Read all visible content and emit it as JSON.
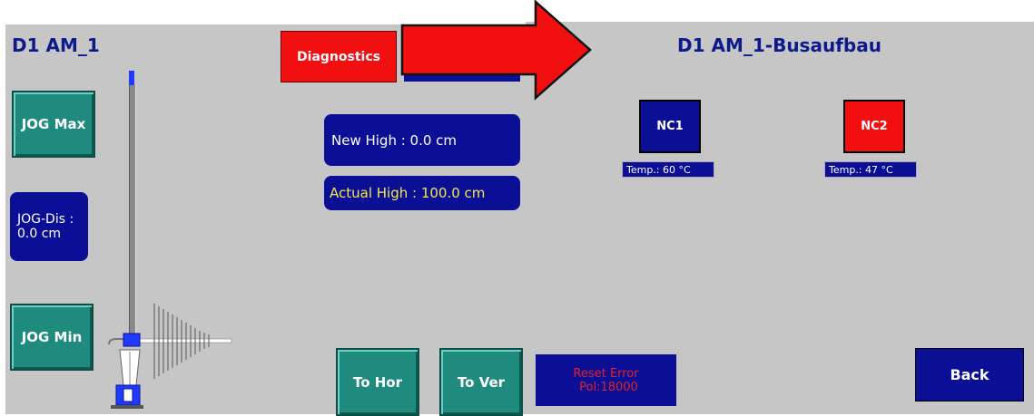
{
  "left": {
    "title": "D1 AM_1",
    "jog_max_label": "JOG Max",
    "jog_min_label": "JOG Min",
    "jog_dis_label": "JOG-Dis :",
    "jog_dis_value": "0.0 cm"
  },
  "center": {
    "diagnostics_label": "Diagnostics",
    "new_high": "New High  :  0.0 cm",
    "actual_high": "Actual High  : 100.0 cm",
    "to_hor_label": "To Hor",
    "to_ver_label": "To Ver",
    "reset_error_line1": "Reset Error",
    "reset_error_line2": "Pol:18000"
  },
  "right": {
    "title": "D1 AM_1-Busaufbau",
    "nc1_label": "NC1",
    "nc1_temp": "Temp.: 60 °C",
    "nc2_label": "NC2",
    "nc2_temp": "Temp.: 47 °C",
    "back_label": "Back"
  },
  "colors": {
    "panel_bg": "#c6c6c6",
    "navy": "#0a0f96",
    "teal": "#1f8a7e",
    "red": "#f20f0f",
    "title_blue": "#0c1a8c",
    "actual_high_text": "#f5e94a",
    "reset_text": "#e22222"
  },
  "icons": {
    "arrow": "big-red-right-arrow",
    "tower": "antenna-tower-icon"
  }
}
